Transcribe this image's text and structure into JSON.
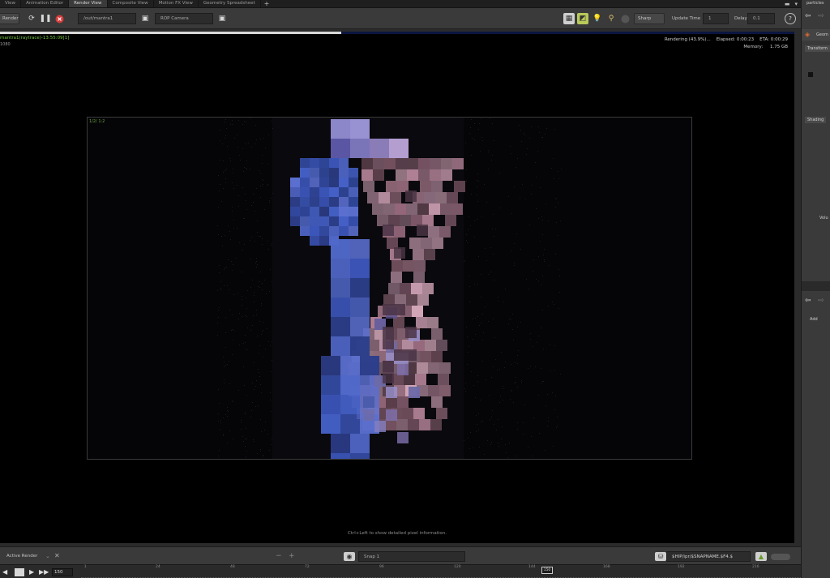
{
  "tabs": [
    {
      "label": "View",
      "active": false
    },
    {
      "label": "Animation Editor",
      "active": false
    },
    {
      "label": "Render View",
      "active": true
    },
    {
      "label": "Composite View",
      "active": false
    },
    {
      "label": "Motion FX View",
      "active": false
    },
    {
      "label": "Geometry Spreadsheet",
      "active": false
    }
  ],
  "toolbar": {
    "render_label": "Render",
    "output_path": "/out/mantra1",
    "camera": "ROP Camera",
    "sharp_label": "Sharp",
    "update_time_label": "Update Time",
    "update_time_value": "1",
    "delay_label": "Delay",
    "delay_value": "0.1"
  },
  "render": {
    "name": "mantra1(raytrace)-13:55:09[1]",
    "sub": "1080",
    "progress_fraction": 0.43,
    "status": "Rendering (43.9%)...",
    "elapsed": "Elapsed: 0:00:23",
    "eta": "ETA: 0:00:29",
    "memory_label": "Memory:",
    "memory_value": "1.75 GB",
    "frame_label": "1/2/ 1:2",
    "hint": "Ctrl+Left to show detailed pixel information."
  },
  "bottom": {
    "active_render_label": "Active Render",
    "snap_label": "Snap 1",
    "path_field": "$HIP/ipr/$SNAPNAME.$F4.$"
  },
  "timeline": {
    "current_frame": "150",
    "frame_marker": "150",
    "ticks": [
      "1",
      "24",
      "48",
      "72",
      "96",
      "120",
      "144",
      "168",
      "192",
      "216"
    ]
  },
  "right_panel": {
    "title": "particles",
    "geo_label": "Geom",
    "transform_tab": "Transform",
    "shading_tab": "Shading",
    "volu_label": "Volu",
    "add_label": "Add"
  },
  "colors": {
    "accent_green": "#76c843",
    "progress_blue": "#0b1640",
    "background": "#000000"
  }
}
